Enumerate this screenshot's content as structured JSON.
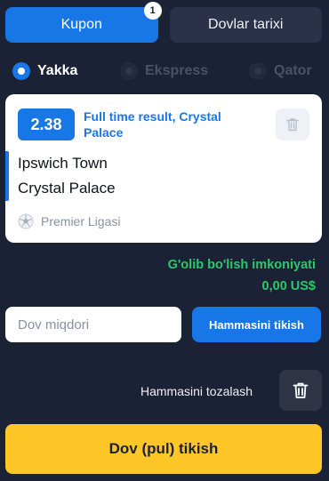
{
  "tabs": [
    {
      "label": "Kupon",
      "badge": "1"
    },
    {
      "label": "Dovlar tarixi"
    }
  ],
  "modes": [
    {
      "label": "Yakka",
      "selected": true
    },
    {
      "label": "Ekspress",
      "selected": false
    },
    {
      "label": "Qator",
      "selected": false
    }
  ],
  "bet": {
    "odds": "2.38",
    "market": "Full time result, Crystal Palace",
    "team_home": "Ipswich Town",
    "team_away": "Crystal Palace",
    "league": "Premier Ligasi"
  },
  "potential": {
    "label": "G'olib bo'lish imkoniyati",
    "value": "0,00 US$"
  },
  "stake": {
    "placeholder": "Dov miqdori",
    "all_in_label": "Hammasini tikish"
  },
  "clear_all_label": "Hammasini tozalash",
  "place_bet_label": "Dov (pul) tikish",
  "colors": {
    "background": "#1b2236",
    "accent": "#1877e6",
    "success": "#2ec76a",
    "cta": "#ffc627"
  },
  "icons": [
    "trash-icon",
    "soccer-ball-icon"
  ]
}
